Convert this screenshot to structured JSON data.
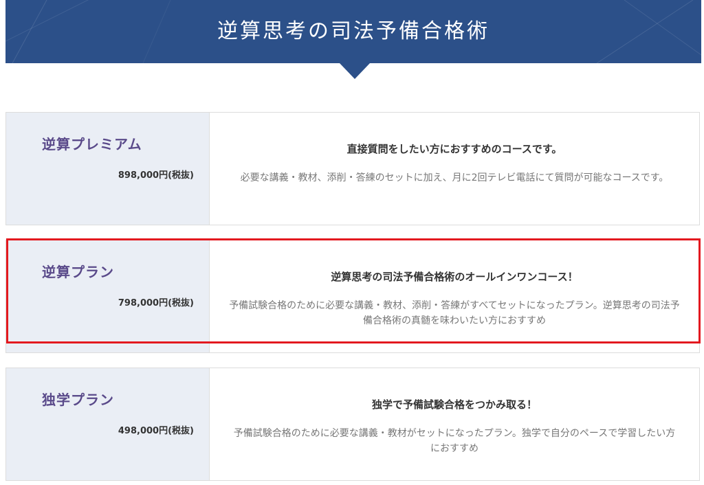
{
  "banner": {
    "title": "逆算思考の司法予備合格術"
  },
  "plans": [
    {
      "name": "逆算プレミアム",
      "price": "898,000円(税抜)",
      "heading": "直接質問をしたい方におすすめのコースです。",
      "description": "必要な講義・教材、添削・答練のセットに加え、月に2回テレビ電話にて質問が可能なコースです。"
    },
    {
      "name": "逆算プラン",
      "price": "798,000円(税抜)",
      "heading": "逆算思考の司法予備合格術のオールインワンコース！",
      "description": "予備試験合格のために必要な講義・教材、添削・答練がすべてセットになったプラン。逆算思考の司法予備合格術の真髄を味わいたい方におすすめ"
    },
    {
      "name": "独学プラン",
      "price": "498,000円(税抜)",
      "heading": "独学で予備試験合格をつかみ取る！",
      "description": "予備試験合格のために必要な講義・教材がセットになったプラン。独学で自分のペースで学習したい方におすすめ"
    }
  ],
  "colors": {
    "banner": "#2c5089",
    "plan_name": "#5a4a8a",
    "left_panel": "#eaeef5",
    "highlight": "#e3191f"
  }
}
